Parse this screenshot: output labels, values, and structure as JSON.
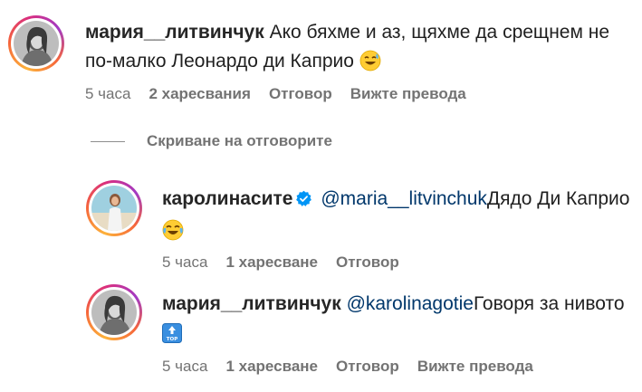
{
  "comments": [
    {
      "username": "мария__литвинчук",
      "text": "Ако бяхме и аз, щяхме да срещнем не по-малко Леонардо ди Каприо",
      "emoji": "sweat-smile-emoji",
      "time": "5 часа",
      "likes": "2 харесвания",
      "reply": "Отговор",
      "translate": "Вижте превода"
    }
  ],
  "hide_replies_label": "Скриване на отговорите",
  "replies": [
    {
      "username": "каролинасите",
      "verified": true,
      "mention": "@maria__litvinchuk",
      "text": "Дядо Ди Каприо",
      "emoji": "joy-emoji",
      "time": "5 часа",
      "likes": "1 харесване",
      "reply": "Отговор"
    },
    {
      "username": "мария__литвинчук",
      "mention": "@karolinagotie",
      "text": "Говоря за нивото",
      "emoji": "top-arrow-emoji",
      "time": "5 часа",
      "likes": "1 харесване",
      "reply": "Отговор",
      "translate": "Вижте превода"
    }
  ],
  "colors": {
    "mention": "#00376b",
    "meta": "#737373",
    "verified": "#0095f6"
  }
}
